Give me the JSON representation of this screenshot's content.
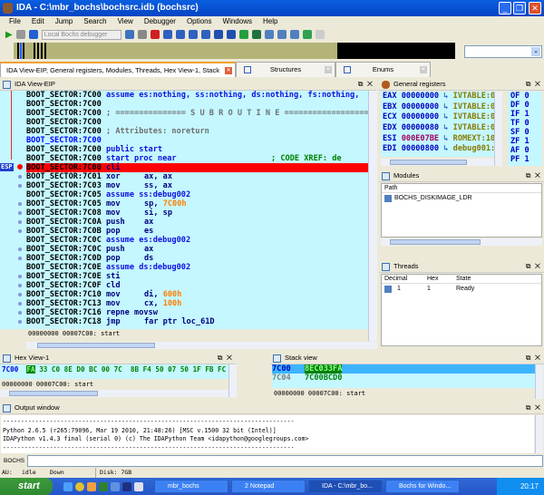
{
  "window": {
    "title": "IDA - C:\\mbr_bochs\\bochsrc.idb (bochsrc)"
  },
  "menu": [
    "File",
    "Edit",
    "Jump",
    "Search",
    "View",
    "Debugger",
    "Options",
    "Windows",
    "Help"
  ],
  "toolbar": {
    "debugger_select": "Local Bochs debugger"
  },
  "tabs": [
    {
      "label": "IDA View-EIP, General registers, Modules, Threads, Hex View-1, Stack view",
      "active": true
    },
    {
      "label": "Structures",
      "active": false
    },
    {
      "label": "Enums",
      "active": false
    }
  ],
  "ida_view": {
    "title": "IDA View-EIP",
    "esp_label": "ESP",
    "lines": [
      {
        "addr": "BOOT_SECTOR:7C00",
        "mn": "",
        "ops": "assume es:nothing, ss:nothing, ds:nothing, fs:nothing,",
        "cls": "c-blue"
      },
      {
        "addr": "BOOT_SECTOR:7C00",
        "mn": "",
        "ops": "",
        "cls": ""
      },
      {
        "addr": "BOOT_SECTOR:7C00",
        "mn": "",
        "ops": "; =============== S U B R O U T I N E =======================================",
        "cls": "c-gray"
      },
      {
        "addr": "BOOT_SECTOR:7C00",
        "mn": "",
        "ops": "",
        "cls": ""
      },
      {
        "addr": "BOOT_SECTOR:7C00",
        "mn": "",
        "ops": "; Attributes: noreturn",
        "cls": "c-gray"
      },
      {
        "addr": "BOOT_SECTOR:7C00",
        "mn": "",
        "ops": "",
        "cls": "",
        "blue": true
      },
      {
        "addr": "BOOT_SECTOR:7C00",
        "mn": "",
        "ops": "public start",
        "cls": "c-blue"
      },
      {
        "addr": "BOOT_SECTOR:7C00",
        "mn": "",
        "ops": "start proc near",
        "cls": "c-blue",
        "comment": "; CODE XREF: de"
      },
      {
        "addr": "BOOT_SECTOR:7C00",
        "mn": "cli",
        "ops": "",
        "cls": "",
        "hl": true,
        "bp": true
      },
      {
        "addr": "BOOT_SECTOR:7C01",
        "mn": "xor",
        "ops": "ax, ax",
        "cls": "c-navy",
        "dot": true
      },
      {
        "addr": "BOOT_SECTOR:7C03",
        "mn": "mov",
        "ops": "ss, ax",
        "cls": "c-navy",
        "dot": true
      },
      {
        "addr": "BOOT_SECTOR:7C05",
        "mn": "",
        "ops": "assume ss:debug002",
        "cls": "c-blue"
      },
      {
        "addr": "BOOT_SECTOR:7C05",
        "mn": "mov",
        "ops": "sp, ",
        "imm": "7C00h",
        "cls": "c-navy",
        "dot": true
      },
      {
        "addr": "BOOT_SECTOR:7C08",
        "mn": "mov",
        "ops": "si, sp",
        "cls": "c-navy",
        "dot": true
      },
      {
        "addr": "BOOT_SECTOR:7C0A",
        "mn": "push",
        "ops": "ax",
        "cls": "c-navy",
        "dot": true
      },
      {
        "addr": "BOOT_SECTOR:7C0B",
        "mn": "pop",
        "ops": "es",
        "cls": "c-navy",
        "dot": true
      },
      {
        "addr": "BOOT_SECTOR:7C0C",
        "mn": "",
        "ops": "assume es:debug002",
        "cls": "c-blue"
      },
      {
        "addr": "BOOT_SECTOR:7C0C",
        "mn": "push",
        "ops": "ax",
        "cls": "c-navy",
        "dot": true
      },
      {
        "addr": "BOOT_SECTOR:7C0D",
        "mn": "pop",
        "ops": "ds",
        "cls": "c-navy",
        "dot": true
      },
      {
        "addr": "BOOT_SECTOR:7C0E",
        "mn": "",
        "ops": "assume ds:debug002",
        "cls": "c-blue"
      },
      {
        "addr": "BOOT_SECTOR:7C0E",
        "mn": "sti",
        "ops": "",
        "cls": "c-navy",
        "dot": true
      },
      {
        "addr": "BOOT_SECTOR:7C0F",
        "mn": "cld",
        "ops": "",
        "cls": "c-navy",
        "dot": true
      },
      {
        "addr": "BOOT_SECTOR:7C10",
        "mn": "mov",
        "ops": "di, ",
        "imm": "600h",
        "cls": "c-navy",
        "dot": true
      },
      {
        "addr": "BOOT_SECTOR:7C13",
        "mn": "mov",
        "ops": "cx, ",
        "imm": "100h",
        "cls": "c-navy",
        "dot": true
      },
      {
        "addr": "BOOT_SECTOR:7C16",
        "mn": "repne movsw",
        "ops": "",
        "cls": "c-navy",
        "dot": true
      },
      {
        "addr": "BOOT_SECTOR:7C18",
        "mn": "jmp",
        "ops": "far ptr loc_61D",
        "cls": "c-navy",
        "dot": true
      }
    ],
    "status": "00000000 00007C00: start"
  },
  "registers": {
    "title": "General registers",
    "rows": [
      {
        "name": "EAX",
        "value": "00000000",
        "ref": "IVTABLE:0",
        "changed": false
      },
      {
        "name": "EBX",
        "value": "00000000",
        "ref": "IVTABLE:0",
        "changed": false
      },
      {
        "name": "ECX",
        "value": "00000000",
        "ref": "IVTABLE:0",
        "changed": false
      },
      {
        "name": "EDX",
        "value": "00000080",
        "ref": "IVTABLE:0",
        "changed": false
      },
      {
        "name": "ESI",
        "value": "000E07BE",
        "ref": "ROMEXT:10",
        "changed": true
      },
      {
        "name": "EDI",
        "value": "00000800",
        "ref": "debug001:",
        "changed": false
      }
    ],
    "flags": [
      {
        "name": "OF",
        "value": "0"
      },
      {
        "name": "DF",
        "value": "0"
      },
      {
        "name": "IF",
        "value": "1"
      },
      {
        "name": "TF",
        "value": "0"
      },
      {
        "name": "SF",
        "value": "0"
      },
      {
        "name": "ZF",
        "value": "1"
      },
      {
        "name": "AF",
        "value": "0"
      },
      {
        "name": "PF",
        "value": "1"
      }
    ]
  },
  "modules": {
    "title": "Modules",
    "column": "Path",
    "items": [
      "BOCHS_DISKIMAGE_LDR"
    ]
  },
  "threads": {
    "title": "Threads",
    "columns": [
      "Decimal",
      "Hex",
      "State"
    ],
    "rows": [
      {
        "decimal": "1",
        "hex": "1",
        "state": "Ready"
      }
    ]
  },
  "hex_view": {
    "title": "Hex View-1",
    "addr": "7C00",
    "bytes": [
      "FA",
      "33",
      "C0",
      "8E",
      "D0",
      "BC",
      "00",
      "7C",
      "8B",
      "F4",
      "50",
      "07",
      "50",
      "1F",
      "FB",
      "FC"
    ],
    "status": "00000000 00007C00: start"
  },
  "stack_view": {
    "title": "Stack view",
    "rows": [
      {
        "addr": "7C00",
        "value": "8EC033FA"
      },
      {
        "addr": "7C04",
        "value": "7C00BCD0"
      }
    ],
    "status": "00000000 00007C00: start"
  },
  "output": {
    "title": "Output window",
    "lines": [
      "---------------------------------------------------------------------------------",
      "Python 2.6.5 (r265:79096, Mar 19 2010, 21:48:26) [MSC v.1500 32 bit (Intel)]",
      "IDAPython v1.4.3 final (serial 0) (c) The IDAPython Team <idapython@googlegroups.com>",
      "---------------------------------------------------------------------------------"
    ]
  },
  "command": {
    "label": "BOCHS",
    "value": ""
  },
  "statusbar": {
    "au": "AU:",
    "state": "idle",
    "direction": "Down",
    "disk": "Disk: 7GB"
  },
  "taskbar": {
    "start": "start",
    "items": [
      {
        "label": "mbr_bochs"
      },
      {
        "label": "2 Notepad"
      },
      {
        "label": "IDA - C:\\mbr_bo...",
        "active": true
      },
      {
        "label": "Bochs for Windo..."
      }
    ],
    "clock": "20:17"
  },
  "colors": {
    "highlight": "#ff0000",
    "code_bg": "#c4f7ff",
    "titlebar": "#0a5fe0"
  }
}
